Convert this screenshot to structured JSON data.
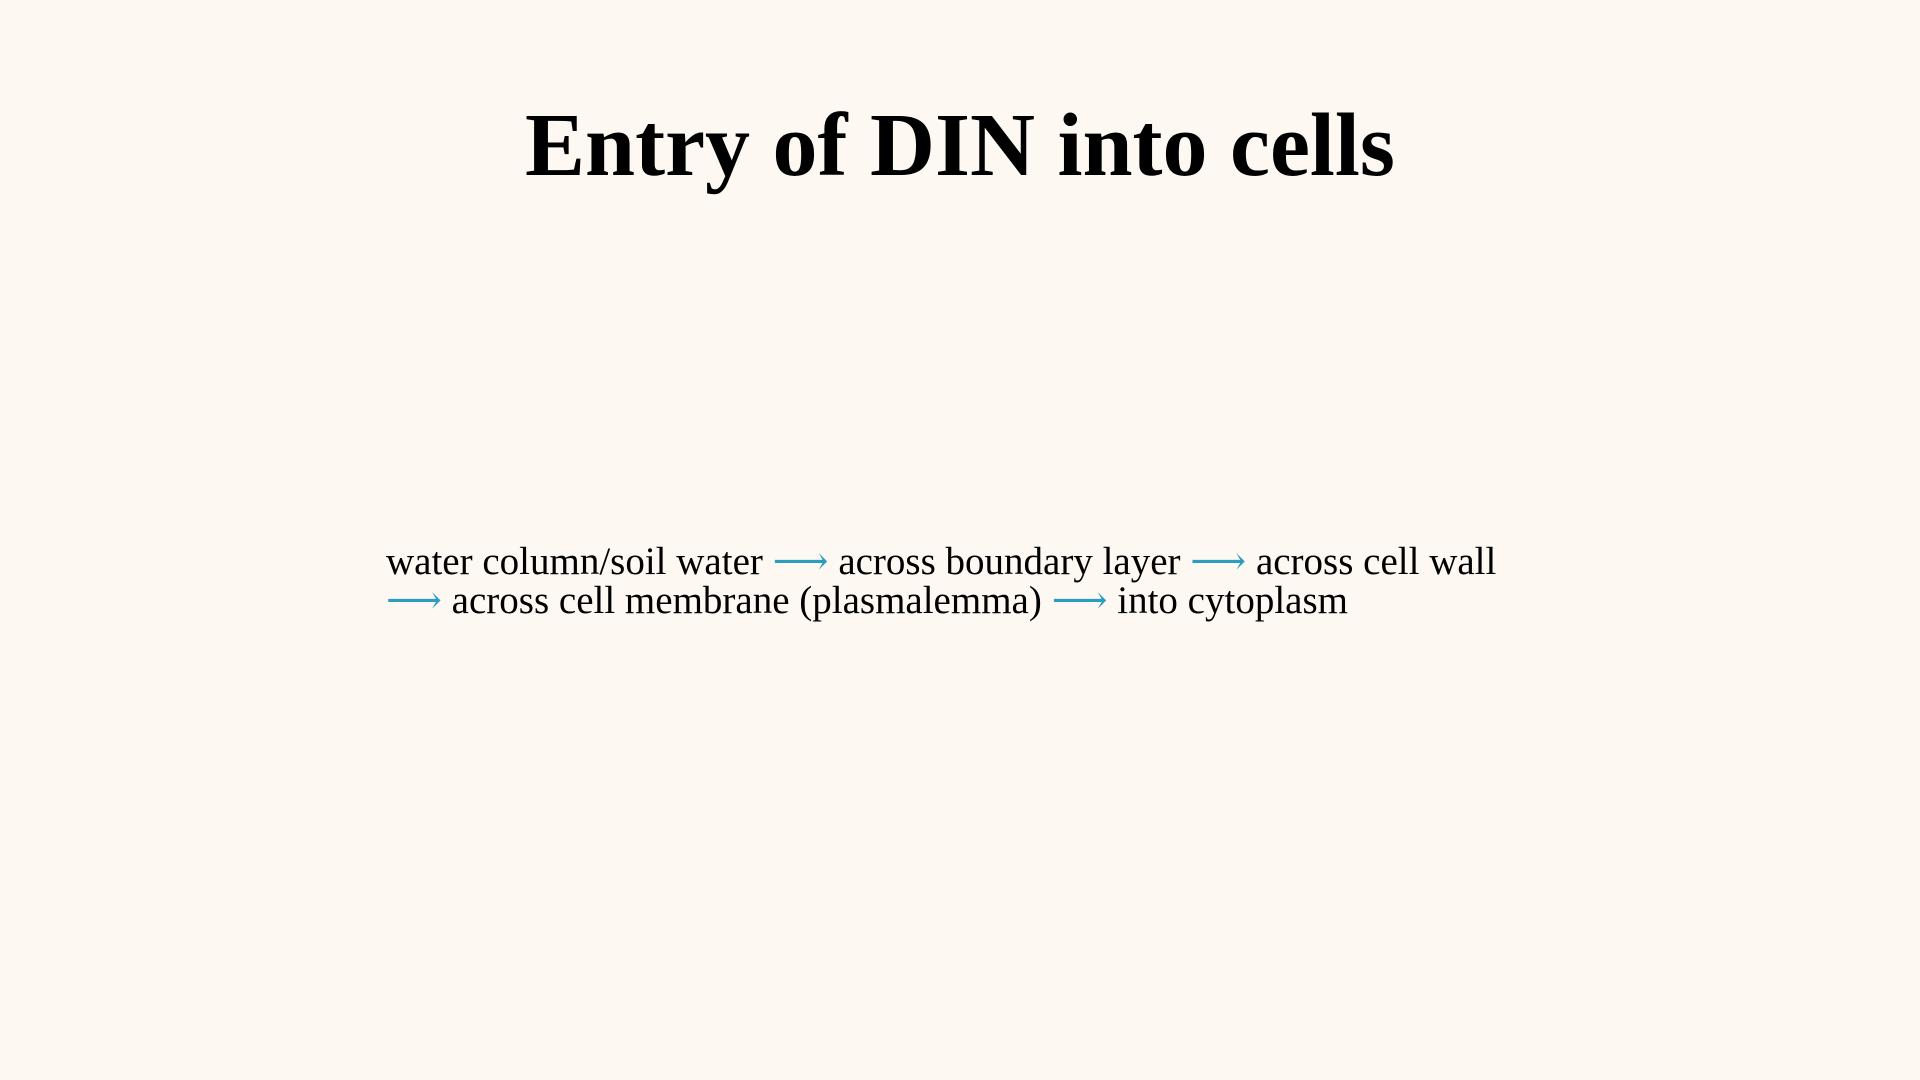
{
  "slide": {
    "title": "Entry of DIN into cells",
    "flow": {
      "arrow": "⟶",
      "line1": {
        "step1": "water column/soil water",
        "step2": "across boundary layer",
        "step3": "across cell wall"
      },
      "line2": {
        "step4": "across cell membrane (plasmalemma)",
        "step5": "into cytoplasm"
      }
    }
  },
  "colors": {
    "background": "#fdf9f2",
    "text": "#000000",
    "arrow": "#2a9dc1"
  }
}
